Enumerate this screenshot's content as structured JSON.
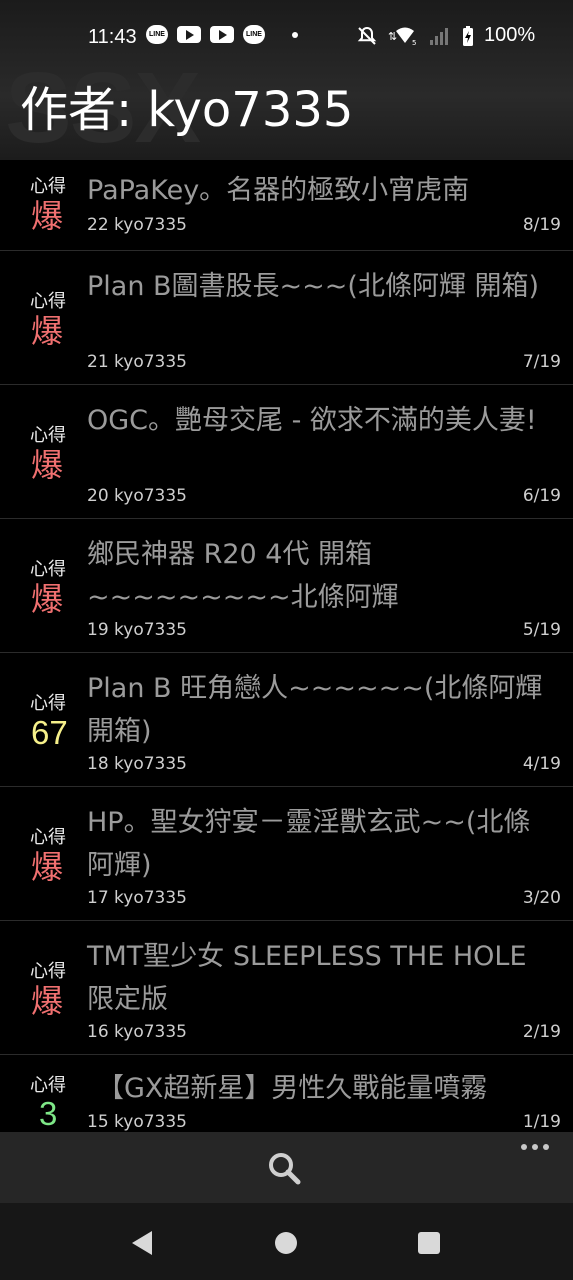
{
  "status": {
    "time": "11:43",
    "line_icon_text": "LINE",
    "battery_text": "100%"
  },
  "header": {
    "watermark": "SSX",
    "title": "作者: kyo7335"
  },
  "items": [
    {
      "tag": "心得",
      "heat": "爆",
      "heat_color": "#f07070",
      "title": "PaPaKey。名器的極致小宵虎南",
      "meta": "22 kyo7335",
      "date": "8/19"
    },
    {
      "tag": "心得",
      "heat": "爆",
      "heat_color": "#f07070",
      "title": "Plan B圖書股長~~~(北條阿輝 開箱)",
      "meta": "21 kyo7335",
      "date": "7/19"
    },
    {
      "tag": "心得",
      "heat": "爆",
      "heat_color": "#f07070",
      "title": "OGC。艷母交尾 - 欲求不滿的美人妻!",
      "meta": "20 kyo7335",
      "date": "6/19"
    },
    {
      "tag": "心得",
      "heat": "爆",
      "heat_color": "#f07070",
      "title": "鄉民神器 R20 4代 開箱~~~~~~~~~北條阿輝",
      "meta": "19 kyo7335",
      "date": "5/19"
    },
    {
      "tag": "心得",
      "heat": "67",
      "heat_color": "#f6f08a",
      "title": "Plan B 旺角戀人~~~~~~(北條阿輝開箱)",
      "meta": "18 kyo7335",
      "date": "4/19"
    },
    {
      "tag": "心得",
      "heat": "爆",
      "heat_color": "#f07070",
      "title": "HP。聖女狩宴－靈淫獸玄武~~(北條阿輝)",
      "meta": "17 kyo7335",
      "date": "3/20"
    },
    {
      "tag": "心得",
      "heat": "爆",
      "heat_color": "#f07070",
      "title": "TMT聖少女 SLEEPLESS THE HOLE 限定版",
      "meta": "16 kyo7335",
      "date": "2/19"
    },
    {
      "tag": "心得",
      "heat": "3",
      "heat_color": "#7ee787",
      "title": "【GX超新星】男性久戰能量噴霧",
      "meta": "15 kyo7335",
      "date": "1/19"
    }
  ],
  "icons": {
    "search": "search-icon",
    "more": "more-options-icon",
    "back": "back-icon",
    "home": "home-icon",
    "recents": "recents-icon"
  }
}
